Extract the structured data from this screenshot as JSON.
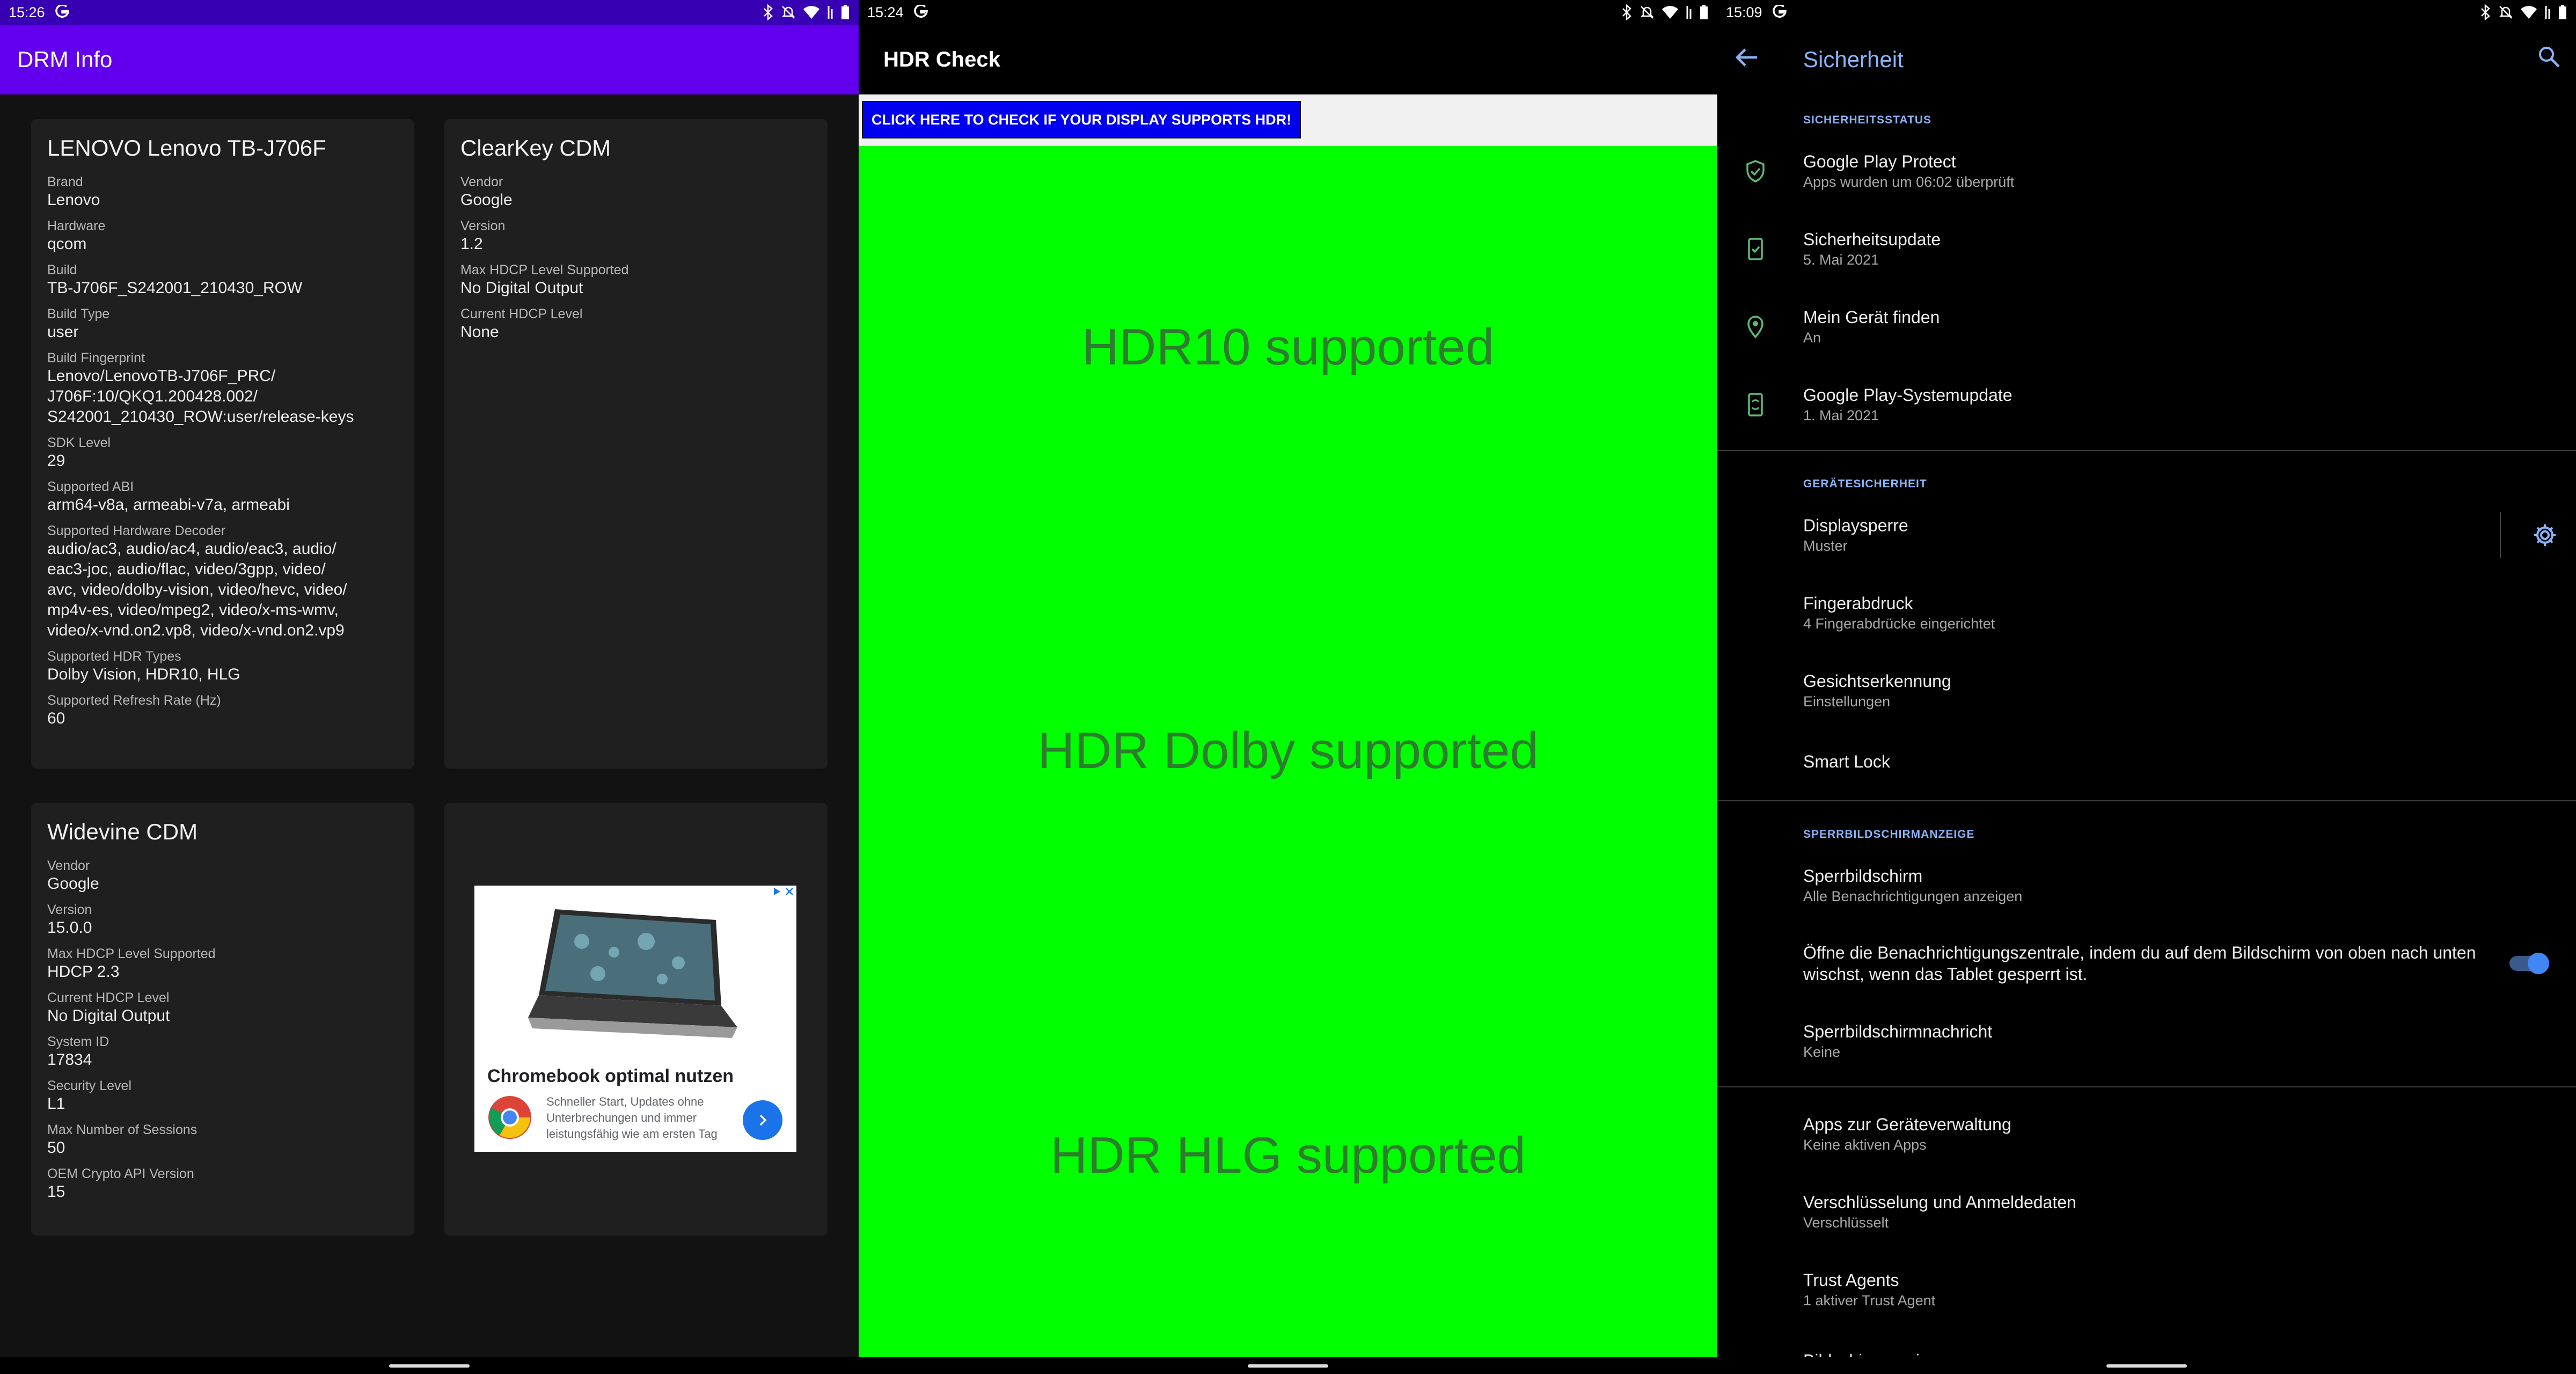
{
  "drm": {
    "status_time": "15:26",
    "app_title": "DRM Info",
    "device": {
      "title": "LENOVO Lenovo TB-J706F",
      "fields": [
        {
          "label": "Brand",
          "value": "Lenovo"
        },
        {
          "label": "Hardware",
          "value": "qcom"
        },
        {
          "label": "Build",
          "value": "TB-J706F_S242001_210430_ROW"
        },
        {
          "label": "Build Type",
          "value": "user"
        },
        {
          "label": "Build Fingerprint",
          "value": "Lenovo/LenovoTB-J706F_PRC/\nJ706F:10/QKQ1.200428.002/\nS242001_210430_ROW:user/release-keys"
        },
        {
          "label": "SDK Level",
          "value": "29"
        },
        {
          "label": "Supported ABI",
          "value": "arm64-v8a, armeabi-v7a, armeabi"
        },
        {
          "label": "Supported Hardware Decoder",
          "value": "audio/ac3, audio/ac4, audio/eac3, audio/\neac3-joc, audio/flac, video/3gpp, video/\navc, video/dolby-vision, video/hevc, video/\nmp4v-es, video/mpeg2, video/x-ms-wmv,\nvideo/x-vnd.on2.vp8, video/x-vnd.on2.vp9"
        },
        {
          "label": "Supported HDR Types",
          "value": "Dolby Vision, HDR10, HLG"
        },
        {
          "label": "Supported Refresh Rate (Hz)",
          "value": "60"
        }
      ]
    },
    "clearkey": {
      "title": "ClearKey CDM",
      "fields": [
        {
          "label": "Vendor",
          "value": "Google"
        },
        {
          "label": "Version",
          "value": "1.2"
        },
        {
          "label": "Max HDCP Level Supported",
          "value": "No Digital Output"
        },
        {
          "label": "Current HDCP Level",
          "value": "None"
        }
      ]
    },
    "widevine": {
      "title": "Widevine CDM",
      "fields": [
        {
          "label": "Vendor",
          "value": "Google"
        },
        {
          "label": "Version",
          "value": "15.0.0"
        },
        {
          "label": "Max HDCP Level Supported",
          "value": "HDCP 2.3"
        },
        {
          "label": "Current HDCP Level",
          "value": "No Digital Output"
        },
        {
          "label": "System ID",
          "value": "17834"
        },
        {
          "label": "Security Level",
          "value": "L1"
        },
        {
          "label": "Max Number of Sessions",
          "value": "50"
        },
        {
          "label": "OEM Crypto API Version",
          "value": "15"
        }
      ]
    },
    "ad": {
      "headline": "Chromebook optimal nutzen",
      "body": "Schneller Start, Updates ohne Unterbrechungen und immer leistungsfähig wie am ersten Tag"
    }
  },
  "hdr": {
    "status_time": "15:24",
    "app_title": "HDR Check",
    "check_button": "CLICK HERE TO CHECK IF YOUR DISPLAY SUPPORTS HDR!",
    "results": [
      "HDR10 supported",
      "HDR Dolby supported",
      "HDR HLG supported"
    ],
    "background_color": "#00ff00"
  },
  "security": {
    "status_time": "15:09",
    "title": "Sicherheit",
    "sections": [
      {
        "header": "SICHERHEITSSTATUS",
        "items": [
          {
            "title": "Google Play Protect",
            "subtitle": "Apps wurden um 06:02 überprüft",
            "icon": "shield-check-icon"
          },
          {
            "title": "Sicherheitsupdate",
            "subtitle": "5. Mai 2021",
            "icon": "phone-check-icon"
          },
          {
            "title": "Mein Gerät finden",
            "subtitle": "An",
            "icon": "location-pin-icon"
          },
          {
            "title": "Google Play-Systemupdate",
            "subtitle": "1. Mai 2021",
            "icon": "phone-sync-icon"
          }
        ]
      },
      {
        "header": "GERÄTESICHERHEIT",
        "items": [
          {
            "title": "Displaysperre",
            "subtitle": "Muster"
          },
          {
            "title": "Fingerabdruck",
            "subtitle": "4 Fingerabdrücke eingerichtet"
          },
          {
            "title": "Gesichtserkennung",
            "subtitle": "Einstellungen"
          },
          {
            "title": "Smart Lock"
          }
        ]
      },
      {
        "header": "SPERRBILDSCHIRMANZEIGE",
        "items": [
          {
            "title": "Sperrbildschirm",
            "subtitle": "Alle Benachrichtigungen anzeigen"
          },
          {
            "title": "Öffne die Benachrichtigungszentrale, indem du auf dem Bildschirm von oben nach unten wischst, wenn das Tablet gesperrt ist.",
            "toggle": true
          },
          {
            "title": "Sperrbildschirmnachricht",
            "subtitle": "Keine"
          }
        ]
      },
      {
        "header": "",
        "items": [
          {
            "title": "Apps zur Geräteverwaltung",
            "subtitle": "Keine aktiven Apps"
          },
          {
            "title": "Verschlüsselung und Anmeldedaten",
            "subtitle": "Verschlüsselt"
          },
          {
            "title": "Trust Agents",
            "subtitle": "1 aktiver Trust Agent"
          },
          {
            "title": "Bildschirm anpinnen"
          }
        ]
      }
    ],
    "accent_color": "#8ab4f8",
    "icon_color": "#5bb974"
  }
}
